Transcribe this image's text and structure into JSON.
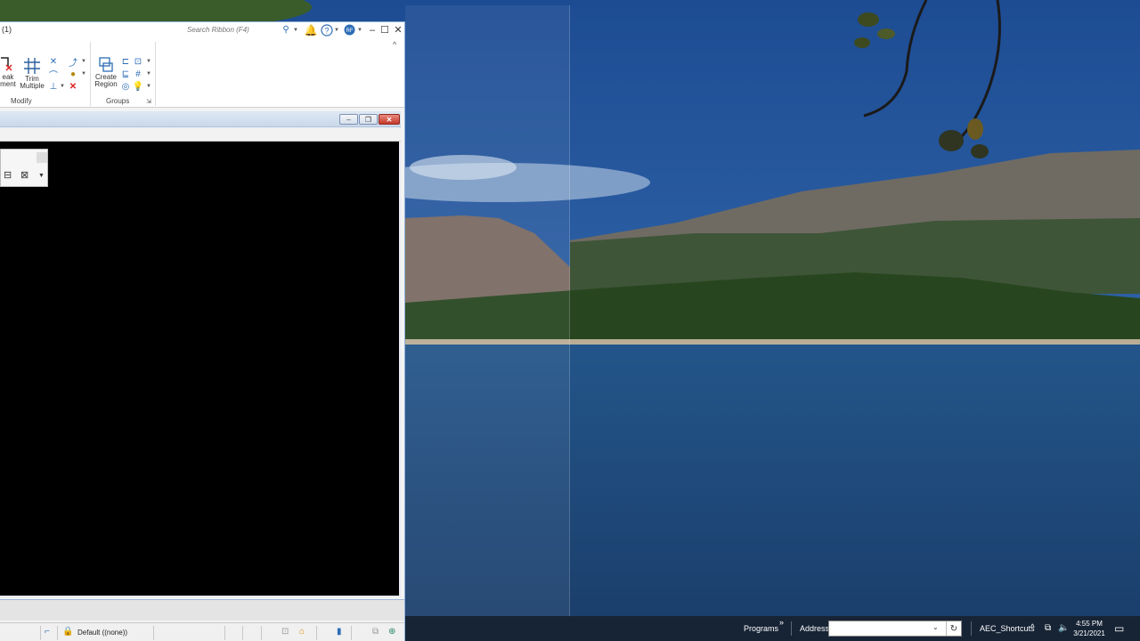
{
  "app": {
    "title": "(1)",
    "search_placeholder": "Search Ribbon (F4)",
    "icons": [
      "search-icon",
      "notification-bell-icon",
      "help-icon",
      "user-avatar-icon",
      "minimize-icon",
      "maximize-icon",
      "close-icon",
      "ribbon-collapse-icon"
    ],
    "user_initials": "RF"
  },
  "ribbon": {
    "break_label": "eak\nment",
    "trim_label": "Trim\nMultiple",
    "create_region_label": "Create\nRegion",
    "modify_panel": "Modify",
    "groups_panel": "Groups"
  },
  "status_bar": {
    "level_text": "Default ((none))"
  },
  "taskbar": {
    "programs_label": "Programs",
    "programs_more": "»",
    "address_label": "Address",
    "address_value": "",
    "toolbar_label": "AEC_Shortcuts",
    "time": "4:55 PM",
    "date": "3/21/2021"
  },
  "colors": {
    "accent": "#2c6db5",
    "sky": "#1f4f8a",
    "taskbar": "#141e2c"
  }
}
